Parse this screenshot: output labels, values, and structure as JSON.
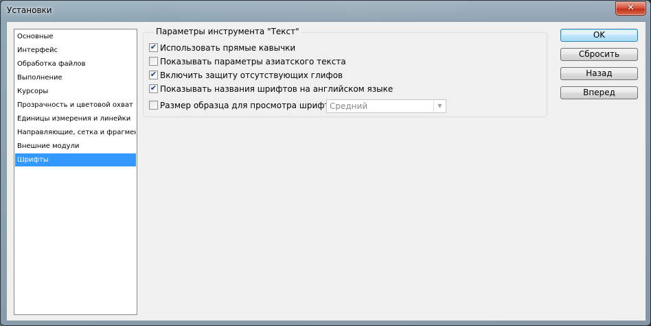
{
  "window": {
    "title": "Установки",
    "close_glyph": "✕"
  },
  "sidebar": {
    "items": [
      {
        "label": "Основные"
      },
      {
        "label": "Интерфейс"
      },
      {
        "label": "Обработка файлов"
      },
      {
        "label": "Выполнение"
      },
      {
        "label": "Курсоры"
      },
      {
        "label": "Прозрачность и цветовой охват"
      },
      {
        "label": "Единицы измерения и линейки"
      },
      {
        "label": "Направляющие, сетка и фрагменты"
      },
      {
        "label": "Внешние модули"
      },
      {
        "label": "Шрифты",
        "selected": true
      }
    ]
  },
  "type_options": {
    "group_title": "Параметры инструмента \"Текст\"",
    "options": [
      {
        "label": "Использовать прямые кавычки",
        "checked": true
      },
      {
        "label": "Показывать параметры азиатского текста",
        "checked": false
      },
      {
        "label": "Включить защиту отсутствующих глифов",
        "checked": true
      },
      {
        "label": "Показывать названия шрифтов на английском языке",
        "checked": true
      },
      {
        "label": "Размер образца для просмотра шрифта:",
        "checked": false
      }
    ],
    "check_glyph": "✔",
    "preview_size": {
      "value": "Средний",
      "enabled": false,
      "arrow_glyph": "▼"
    }
  },
  "buttons": {
    "ok": "OK",
    "reset": "Сбросить",
    "back": "Назад",
    "forward": "Вперед"
  }
}
